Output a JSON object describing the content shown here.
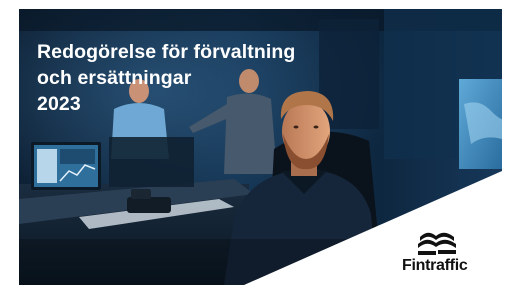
{
  "cover": {
    "title_lines": [
      "Redogörelse för förvaltning",
      "och ersättningar",
      "2023"
    ],
    "brand": {
      "name": "Fintraffic",
      "icon": "fintraffic-waves-logo-icon"
    },
    "colors": {
      "title_text": "#ffffff",
      "brand_text": "#111111",
      "corner_panel": "#ffffff",
      "photo_dominant": "#0d1f33"
    }
  }
}
